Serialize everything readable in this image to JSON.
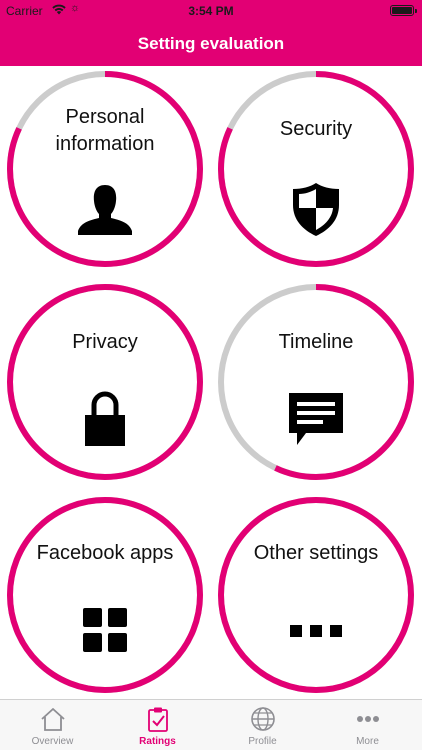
{
  "status_bar": {
    "carrier": "Carrier",
    "time": "3:54 PM",
    "wifi_icon": "wifi-icon",
    "activity_icon": "activity-spinner-icon",
    "battery_icon": "battery-full-icon"
  },
  "header": {
    "title": "Setting evaluation"
  },
  "colors": {
    "accent": "#e20074",
    "ring_track": "#cccccc",
    "tab_inactive": "#8e8e93"
  },
  "tiles": [
    {
      "label": "Personal information",
      "icon": "person-icon",
      "progress": 0.82
    },
    {
      "label": "Security",
      "icon": "shield-icon",
      "progress": 0.82
    },
    {
      "label": "Privacy",
      "icon": "lock-icon",
      "progress": 1.0
    },
    {
      "label": "Timeline",
      "icon": "speech-bubble-icon",
      "progress": 0.57
    },
    {
      "label": "Facebook apps",
      "icon": "apps-grid-icon",
      "progress": 1.0
    },
    {
      "label": "Other settings",
      "icon": "more-dots-icon",
      "progress": 1.0
    }
  ],
  "tab_bar": {
    "tabs": [
      {
        "label": "Overview",
        "icon": "home-icon",
        "active": false
      },
      {
        "label": "Ratings",
        "icon": "clipboard-check-icon",
        "active": true
      },
      {
        "label": "Profile",
        "icon": "globe-icon",
        "active": false
      },
      {
        "label": "More",
        "icon": "more-dots-icon",
        "active": false
      }
    ]
  }
}
